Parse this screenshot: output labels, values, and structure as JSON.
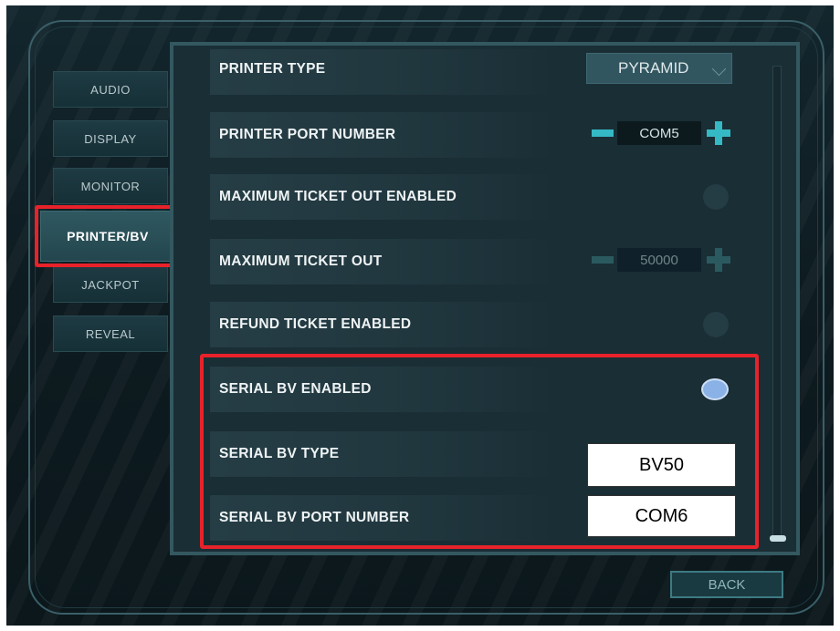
{
  "sidebar": {
    "items": [
      {
        "label": "AUDIO"
      },
      {
        "label": "DISPLAY"
      },
      {
        "label": "MONITOR"
      },
      {
        "label": "PRINTER/BV"
      },
      {
        "label": "JACKPOT"
      },
      {
        "label": "REVEAL"
      }
    ],
    "active": "PRINTER/BV"
  },
  "settings": {
    "printer_type": {
      "label": "PRINTER TYPE",
      "value": "PYRAMID"
    },
    "printer_port": {
      "label": "PRINTER PORT NUMBER",
      "value": "COM5"
    },
    "max_ticket_out_enabled": {
      "label": "MAXIMUM TICKET OUT ENABLED",
      "enabled": false
    },
    "max_ticket_out": {
      "label": "MAXIMUM TICKET OUT",
      "value": "50000",
      "disabled": true
    },
    "refund_ticket_enabled": {
      "label": "REFUND TICKET ENABLED",
      "enabled": false
    },
    "serial_bv_enabled": {
      "label": "SERIAL BV ENABLED",
      "enabled": true
    },
    "serial_bv_type": {
      "label": "SERIAL BV TYPE",
      "value": "BV50"
    },
    "serial_bv_port": {
      "label": "SERIAL BV PORT NUMBER",
      "value": "COM6"
    }
  },
  "footer": {
    "back_label": "BACK"
  },
  "colors": {
    "highlight": "#e8222a",
    "accent": "#35b9c4",
    "toggle_on": "#8bb2e6"
  }
}
